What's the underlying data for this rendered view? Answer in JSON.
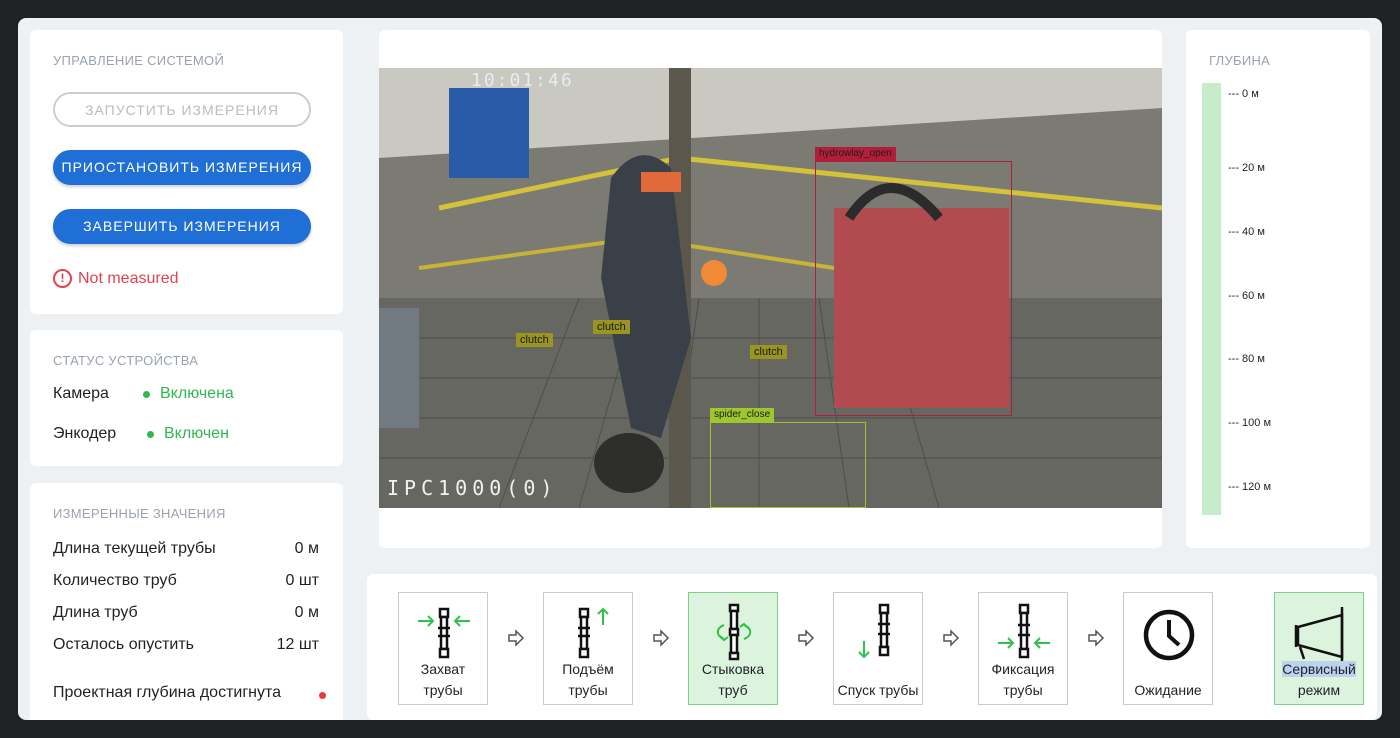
{
  "control": {
    "title": "УПРАВЛЕНИЕ СИСТЕМОЙ",
    "start_label": "ЗАПУСТИТЬ ИЗМЕРЕНИЯ",
    "pause_label": "ПРИОСТАНОВИТЬ ИЗМЕРЕНИЯ",
    "finish_label": "ЗАВЕРШИТЬ ИЗМЕРЕНИЯ",
    "error_icon": "!",
    "error_text": "Not measured"
  },
  "status": {
    "title": "СТАТУС УСТРОЙСТВА",
    "camera_label": "Камера",
    "camera_value": "Включена",
    "encoder_label": "Энкодер",
    "encoder_value": "Включен"
  },
  "measured": {
    "title": "ИЗМЕРЕННЫЕ ЗНАЧЕНИЯ",
    "rows": [
      {
        "label": "Длина текущей трубы",
        "value": "0 м"
      },
      {
        "label": "Количество труб",
        "value": "0 шт"
      },
      {
        "label": "Длина труб",
        "value": "0 м"
      },
      {
        "label": "Осталось опустить",
        "value": "12 шт"
      }
    ],
    "depth_reached_label": "Проектная глубина достигнута",
    "depth_reached_color": "#e63a3a"
  },
  "camera": {
    "timestamp": "10:01:46",
    "device_id": "IPC1000(0)",
    "detections": [
      {
        "label": "hydrowlay_open",
        "color": "#b01e3c"
      },
      {
        "label": "clutch",
        "color": "#9a9420"
      },
      {
        "label": "clutch",
        "color": "#9a9420"
      },
      {
        "label": "clutch",
        "color": "#9a9420"
      },
      {
        "label": "spider_close",
        "color": "#9fc62f"
      }
    ]
  },
  "depth": {
    "title": "ГЛУБИНА",
    "ticks": [
      "--- 0 м",
      "--- 20 м",
      "--- 40 м",
      "--- 60 м",
      "--- 80 м",
      "--- 100 м",
      "--- 120 м"
    ],
    "bar_color": "#c6ecc9",
    "fill_fraction": 0
  },
  "steps": [
    {
      "line1": "Захват",
      "line2": "трубы",
      "icon": "pipe-grab-icon",
      "active": false
    },
    {
      "line1": "Подъём",
      "line2": "трубы",
      "icon": "pipe-lift-icon",
      "active": false
    },
    {
      "line1": "Стыковка",
      "line2": "труб",
      "icon": "pipe-dock-icon",
      "active": true
    },
    {
      "line1": "",
      "line2": "Спуск трубы",
      "icon": "pipe-lower-icon",
      "active": false
    },
    {
      "line1": "Фиксация",
      "line2": "трубы",
      "icon": "pipe-fix-icon",
      "active": false
    },
    {
      "line1": "",
      "line2": "Ожидание",
      "icon": "clock-icon",
      "active": false
    }
  ],
  "service": {
    "line1": "Сервисный",
    "line2": "режим",
    "icon": "megaphone-icon",
    "active": true
  },
  "colors": {
    "primary": "#1f6fd6",
    "success": "#2fb84f",
    "error": "#e0424e",
    "step_green": "#2ec24a"
  }
}
